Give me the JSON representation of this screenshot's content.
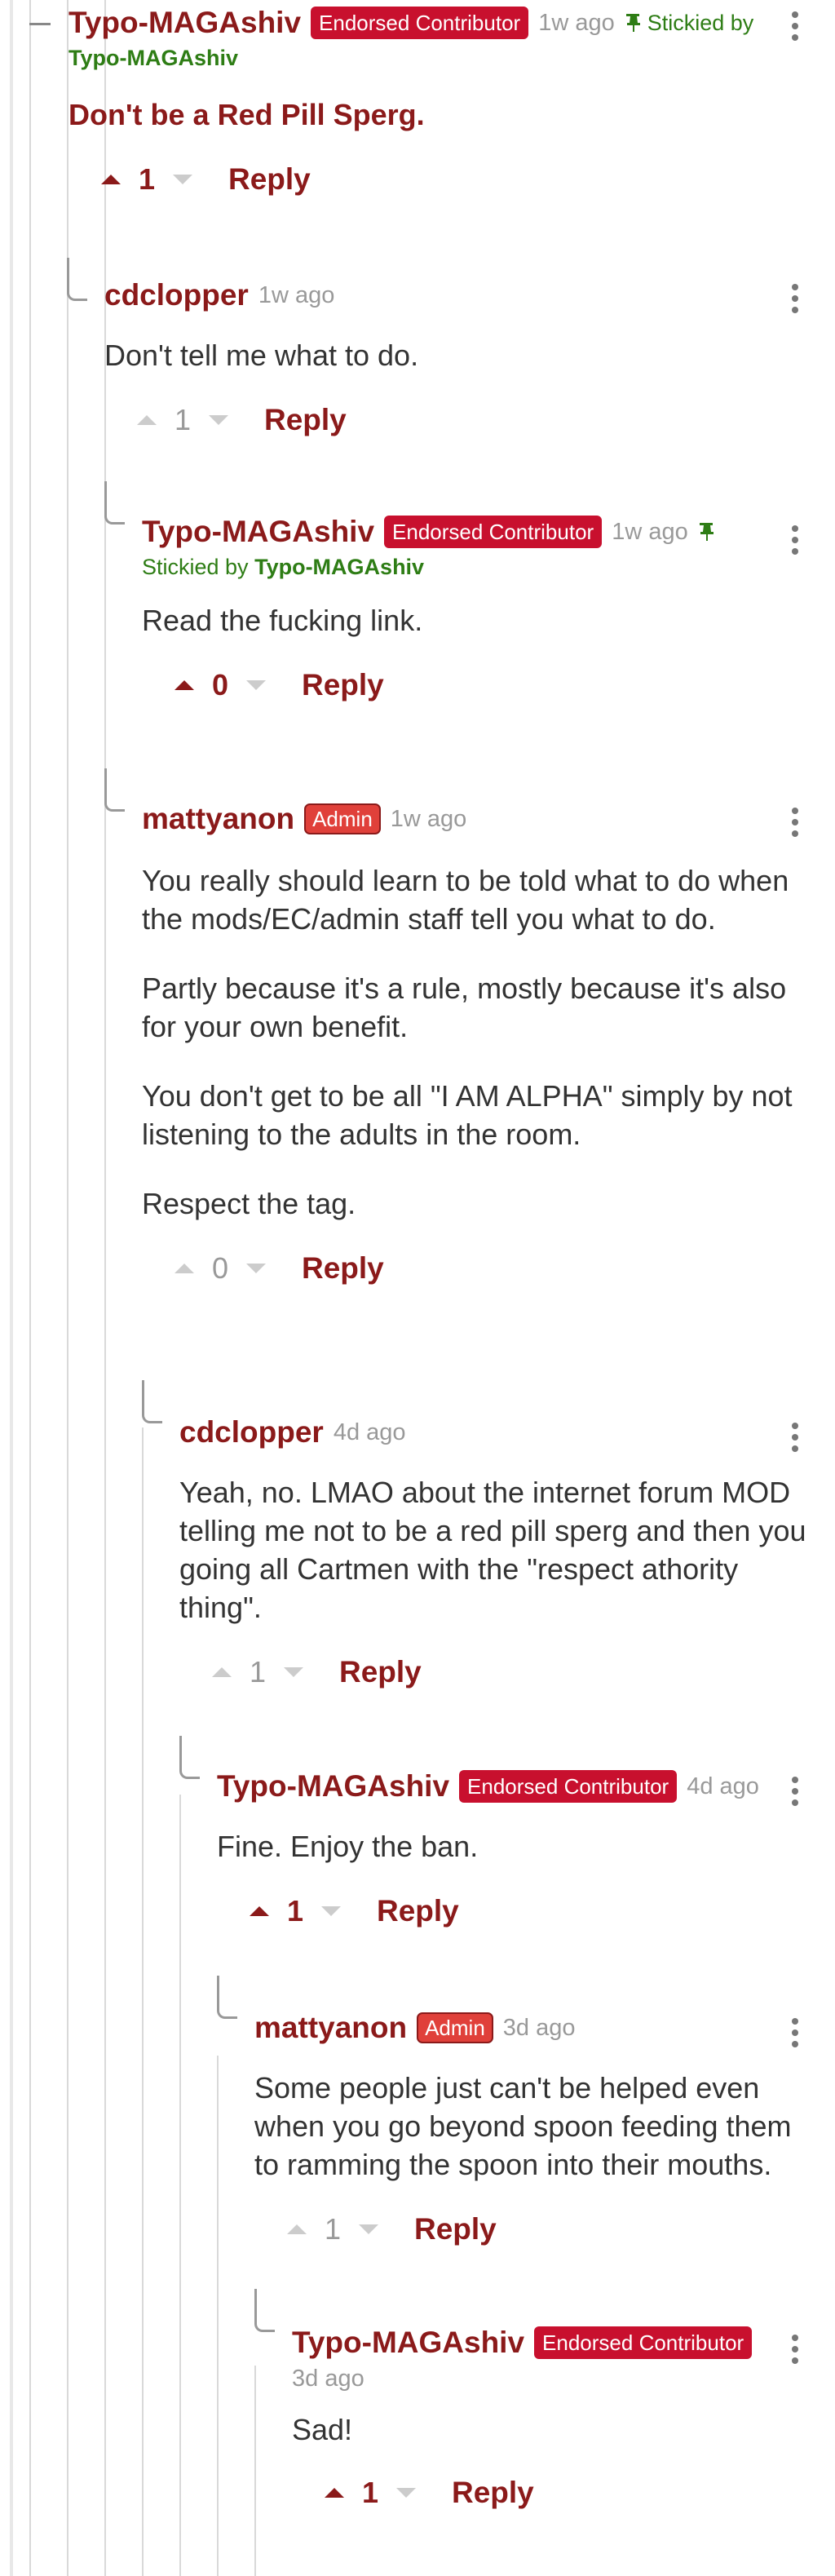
{
  "comments": [
    {
      "author": "Typo-MAGAshiv",
      "badge": "Endorsed Contributor",
      "time": "1w ago",
      "stickied_prefix": "Stickied by",
      "stickied_by": "Typo-MAGAshiv",
      "body": [
        "Don't be a Red Pill Sperg."
      ],
      "score": "1",
      "voted": true,
      "reply": "Reply"
    },
    {
      "author": "cdclopper",
      "time": "1w ago",
      "body": [
        "Don't tell me what to do."
      ],
      "score": "1",
      "voted": false,
      "reply": "Reply"
    },
    {
      "author": "Typo-MAGAshiv",
      "badge": "Endorsed Contributor",
      "time": "1w ago",
      "stickied_prefix": "Stickied by",
      "stickied_by": "Typo-MAGAshiv",
      "body": [
        "Read the fucking link."
      ],
      "score": "0",
      "voted": true,
      "reply": "Reply"
    },
    {
      "author": "mattyanon",
      "badge": "Admin",
      "time": "1w ago",
      "body": [
        "You really should learn to be told what to do when the mods/EC/admin staff tell you what to do.",
        "Partly because it's a rule, mostly because it's also for your own benefit.",
        "You don't get to be all \"I AM ALPHA\" simply by not listening to the adults in the room.",
        "Respect the tag."
      ],
      "score": "0",
      "voted": false,
      "reply": "Reply"
    },
    {
      "author": "cdclopper",
      "time": "4d ago",
      "body": [
        "Yeah, no. LMAO about the internet forum MOD telling me not to be a red pill sperg and then you going all Cartmen with the \"respect athority thing\"."
      ],
      "score": "1",
      "voted": false,
      "reply": "Reply"
    },
    {
      "author": "Typo-MAGAshiv",
      "badge": "Endorsed Contributor",
      "time": "4d ago",
      "body": [
        "Fine. Enjoy the ban."
      ],
      "score": "1",
      "voted": true,
      "reply": "Reply"
    },
    {
      "author": "mattyanon",
      "badge": "Admin",
      "time": "3d ago",
      "body": [
        "Some people just can't be helped even when you go beyond spoon feeding them to ramming the spoon into their mouths."
      ],
      "score": "1",
      "voted": false,
      "reply": "Reply"
    },
    {
      "author": "Typo-MAGAshiv",
      "badge": "Endorsed Contributor",
      "time": "3d ago",
      "body": [
        "Sad!"
      ],
      "score": "1",
      "voted": true,
      "reply": "Reply"
    }
  ]
}
